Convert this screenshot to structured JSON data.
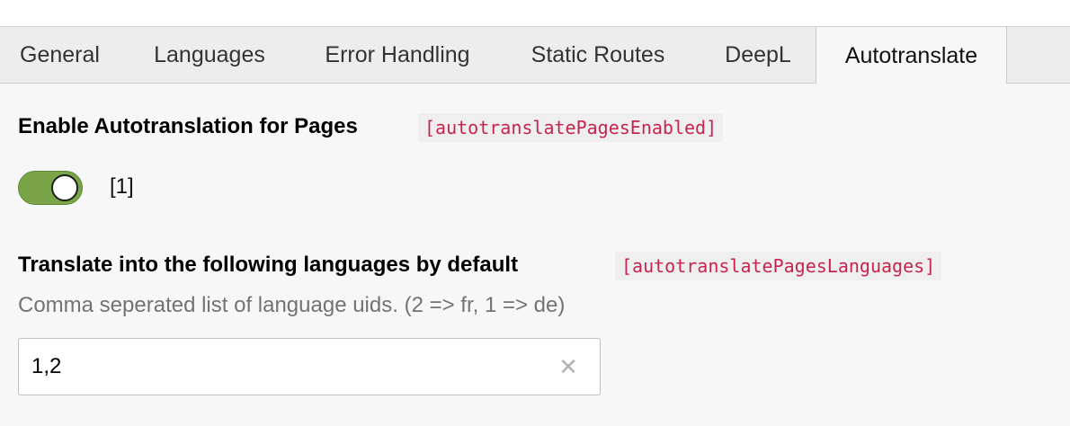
{
  "tabs": [
    {
      "label": "General",
      "active": false
    },
    {
      "label": "Languages",
      "active": false
    },
    {
      "label": "Error Handling",
      "active": false
    },
    {
      "label": "Static Routes",
      "active": false
    },
    {
      "label": "DeepL",
      "active": false
    },
    {
      "label": "Autotranslate",
      "active": true
    }
  ],
  "settings": {
    "autotranslate_pages": {
      "label": "Enable Autotranslation for Pages",
      "key": "[autotranslatePagesEnabled]",
      "toggle_on": true,
      "value_display": "[1]"
    },
    "autotranslate_languages": {
      "label": "Translate into the following languages by default",
      "key": "[autotranslatePagesLanguages]",
      "description": "Comma seperated list of language uids. (2 => fr, 1 => de)",
      "value": "1,2",
      "clear_icon": "close-icon"
    }
  },
  "colors": {
    "toggle_on": "#79a548",
    "code_text": "#c7254e",
    "tab_bar": "#ededed",
    "panel": "#f7f7f7"
  }
}
